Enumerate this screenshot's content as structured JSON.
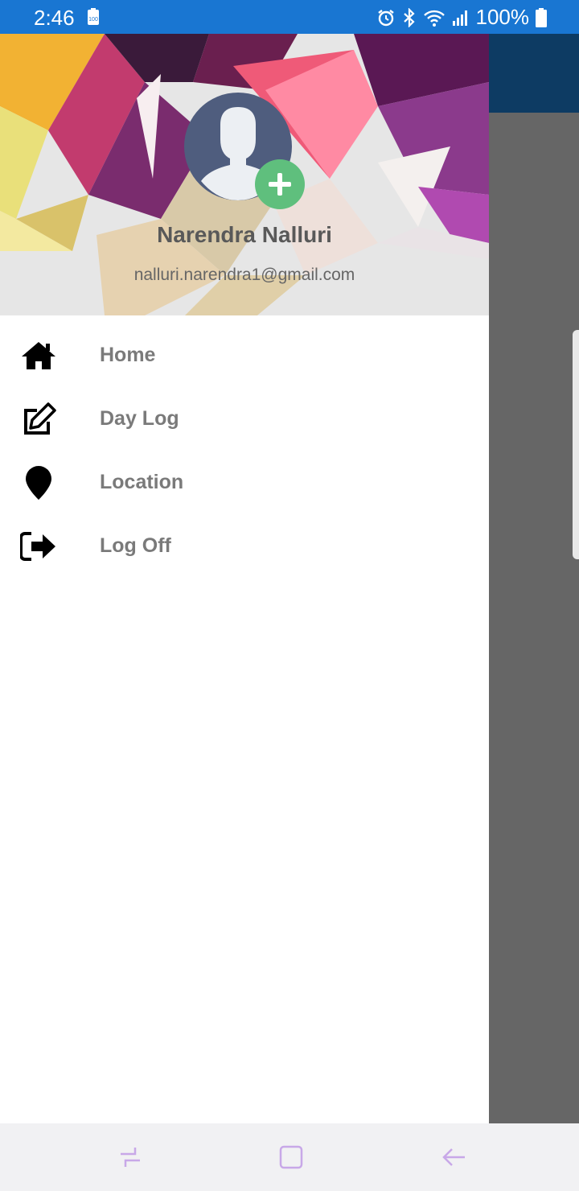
{
  "status_bar": {
    "time": "2:46",
    "battery_percent": "100%",
    "icons": [
      "battery-saver-icon",
      "alarm-icon",
      "bluetooth-icon",
      "wifi-icon",
      "signal-icon",
      "battery-icon"
    ]
  },
  "drawer": {
    "user_name": "Narendra Nalluri",
    "user_email": "nalluri.narendra1@gmail.com",
    "items": [
      {
        "label": "Home",
        "icon": "home-icon"
      },
      {
        "label": "Day Log",
        "icon": "edit-icon"
      },
      {
        "label": "Location",
        "icon": "location-pin-icon"
      },
      {
        "label": "Log Off",
        "icon": "sign-out-icon"
      }
    ]
  },
  "colors": {
    "status_bar": "#1976d2",
    "toolbar": "#0d3b63",
    "scrim": "#666666",
    "add_badge": "#5fbf7d",
    "nav_icons": "#c8a8e8"
  },
  "nav_bar": {
    "buttons": [
      "recent-apps-icon",
      "home-square-icon",
      "back-arrow-icon"
    ]
  }
}
